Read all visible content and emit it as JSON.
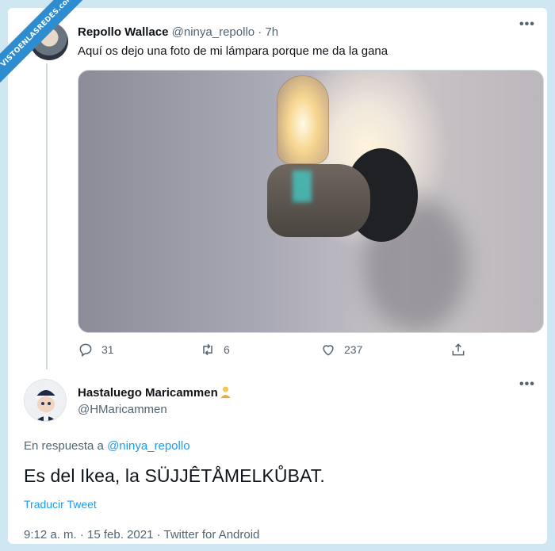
{
  "watermark": {
    "text": "VISTOENLASREDES",
    "sub": ".com"
  },
  "tweet": {
    "author_name": "Repollo Wallace",
    "author_handle": "@ninya_repollo",
    "separator": "·",
    "time": "7h",
    "text": "Aquí os dejo una foto de mi lámpara porque me da la gana",
    "more_label": "•••",
    "replies": "31",
    "retweets": "6",
    "likes": "237"
  },
  "reply": {
    "author_name": "Hastaluego Maricammen",
    "author_handle": "@HMaricammen",
    "more_label": "•••",
    "in_reply_prefix": "En respuesta a",
    "in_reply_handle": "@ninya_repollo",
    "text": "Es del Ikea, la SÜJJÊTÅMELKŮBAT.",
    "translate_label": "Traducir Tweet",
    "timestamp": "9:12 a. m. · 15 feb. 2021 · Twitter for Android"
  },
  "colors": {
    "link": "#1d9bf0",
    "muted": "#536471",
    "background": "#cfe6f3",
    "ribbon": "#2e8dd0"
  },
  "icons": [
    "reply-icon",
    "retweet-icon",
    "like-icon",
    "share-icon",
    "more-icon",
    "person-emoji-icon"
  ]
}
